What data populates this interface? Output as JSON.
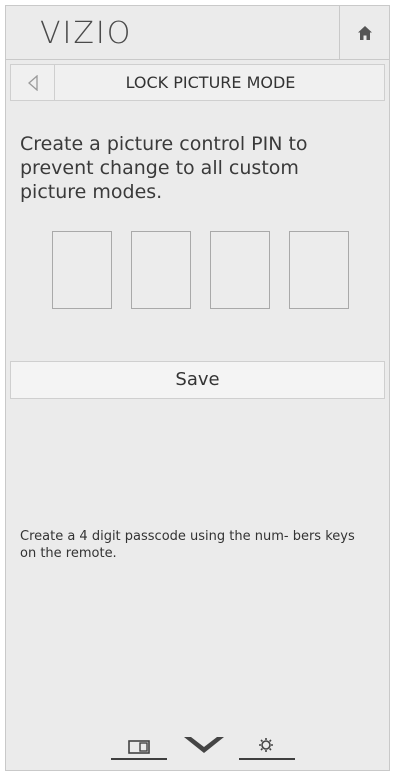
{
  "header": {
    "brand": "VIZIO",
    "home_icon": "home-icon"
  },
  "nav": {
    "back_icon": "back-arrow-icon",
    "title": "LOCK PICTURE MODE"
  },
  "main": {
    "instruction": "Create a picture control PIN to prevent change to all custom picture modes.",
    "pin_boxes": [
      "",
      "",
      "",
      ""
    ],
    "save_label": "Save",
    "hint": "Create a 4 digit passcode using the num- bers keys on the remote."
  },
  "footer": {
    "icons": [
      "input-icon",
      "vizio-v-icon",
      "settings-gear-icon"
    ]
  }
}
